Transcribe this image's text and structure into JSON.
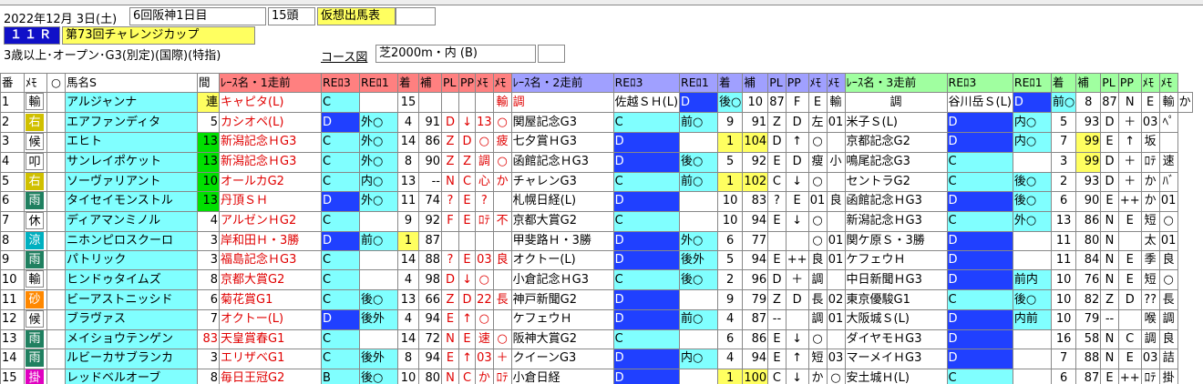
{
  "header": {
    "date": "2022年12月 3日(土)",
    "meeting": "6回阪神1日目",
    "heads": "15頭",
    "mode_badge": "仮想出馬表",
    "race_no": "１１Ｒ",
    "race_name": "第73回チャレンジカップ",
    "conditions": "3歳以上･オープン･G3(別定)(国際)(特指)",
    "course_label": "コース図",
    "course": "芝2000m・内 (B)"
  },
  "columns": {
    "no": "番",
    "memo": "ﾒﾓ",
    "mark": "○",
    "horse": "馬名S",
    "gap": "間",
    "race1": "ﾚｰｽ名・1走前",
    "race2": "ﾚｰｽ名・2走前",
    "race3": "ﾚｰｽ名・3走前",
    "rpci3": "REﾛ3",
    "rpci1": "REﾛ1",
    "pos": "着",
    "ho": "補",
    "pl": "PL",
    "pp": "PP",
    "me": "ﾒﾓ",
    "me2": "ﾒﾓ"
  },
  "colors": {
    "hdr_race1": "#ff8080",
    "hdr_race2": "#a0a0ff",
    "hdr_race3": "#a0ffa0",
    "horse_bg": "#80ffff",
    "blue_cell": "#2040ff",
    "green_gap": "#00e000"
  },
  "rows": [
    {
      "no": "1",
      "badge": "輸",
      "bc": "b-ring",
      "name": "アルジャンナ",
      "gap": "連",
      "gc": "yb",
      "r1": [
        "キャピタ(L)",
        "C",
        "",
        "15",
        "",
        "",
        "",
        "",
        "輸",
        "調"
      ],
      "r2": [
        "佐越ＳＨ(L)",
        "D",
        "後○",
        "10",
        "87",
        "F",
        "E",
        "輸",
        "調"
      ],
      "r3": [
        "谷川岳Ｓ(L)",
        "D",
        "前○",
        "8",
        "87",
        "N",
        "E",
        "輸",
        "か"
      ]
    },
    {
      "no": "2",
      "badge": "右",
      "bc": "b-ye",
      "name": "エアファンディタ",
      "gap": "5",
      "gc": "",
      "r1": [
        "カシオペ(L)",
        "D",
        "外○",
        "4",
        "91",
        "D",
        "↓",
        "13",
        "○"
      ],
      "r2": [
        "関屋記念G3",
        "C",
        "前○",
        "9",
        "91",
        "Z",
        "D",
        "左",
        "01"
      ],
      "r3": [
        "米子Ｓ(L)",
        "D",
        "内○",
        "5",
        "93",
        "D",
        "＋",
        "03",
        "ﾍﾟ"
      ]
    },
    {
      "no": "3",
      "badge": "候",
      "bc": "b-ring",
      "name": "エヒト",
      "gap": "13",
      "gc": "gr",
      "r1": [
        "新潟記念ＨG3",
        "C",
        "外○",
        "14",
        "86",
        "Z",
        "D",
        "○",
        "疲"
      ],
      "r2": [
        "七夕賞ＨG3",
        "D",
        "",
        "1",
        "104",
        "D",
        "↑",
        "○",
        ""
      ],
      "r3": [
        "京都記念G2",
        "D",
        "内○",
        "7",
        "99",
        "E",
        "↑",
        "坂",
        ""
      ]
    },
    {
      "no": "4",
      "badge": "叩",
      "bc": "b-ring",
      "name": "サンレイポケット",
      "gap": "13",
      "gc": "gr",
      "r1": [
        "新潟記念ＨG3",
        "C",
        "外○",
        "8",
        "90",
        "Z",
        "Z",
        "調",
        "○"
      ],
      "r2": [
        "函館記念ＨG3",
        "D",
        "後○",
        "5",
        "92",
        "E",
        "D",
        "瘦",
        "小"
      ],
      "r3": [
        "鳴尾記念G3",
        "C",
        "",
        "3",
        "99",
        "D",
        "＋",
        "ﾛﾃ",
        "速"
      ]
    },
    {
      "no": "5",
      "badge": "右",
      "bc": "b-ye",
      "name": "ソーヴァリアント",
      "gap": "10",
      "gc": "gr",
      "r1": [
        "オールカG2",
        "C",
        "内○",
        "13",
        "--",
        "N",
        "C",
        "心",
        "か"
      ],
      "r2": [
        "チャレンG3",
        "C",
        "前○",
        "1",
        "102",
        "C",
        "↓",
        "○",
        ""
      ],
      "r3": [
        "セントラG2",
        "C",
        "後○",
        "2",
        "93",
        "D",
        "＋",
        "か",
        "ﾊﾞ"
      ]
    },
    {
      "no": "6",
      "badge": "雨",
      "bc": "b-gr",
      "name": "タイセイモンストル",
      "gap": "13",
      "gc": "gr",
      "r1": [
        "丹頂ＳＨ",
        "D",
        "外○",
        "11",
        "74",
        "?",
        "E",
        "?",
        ""
      ],
      "r2": [
        "札幌日経(L)",
        "D",
        "",
        "10",
        "83",
        "?",
        "E",
        "01",
        "良"
      ],
      "r3": [
        "函館記念ＨG3",
        "D",
        "後○",
        "6",
        "90",
        "E",
        "++",
        "か",
        "01"
      ]
    },
    {
      "no": "7",
      "badge": "休",
      "bc": "b-ring",
      "name": "ディアマンミノル",
      "gap": "4",
      "gc": "",
      "r1": [
        "アルゼンＨG2",
        "C",
        "",
        "9",
        "92",
        "F",
        "E",
        "ﾛﾃ",
        "不"
      ],
      "r2": [
        "京都大賞G2",
        "C",
        "",
        "10",
        "94",
        "E",
        "↓",
        "○",
        ""
      ],
      "r3": [
        "新潟記念ＨG3",
        "C",
        "外○",
        "13",
        "86",
        "N",
        "E",
        "短",
        "○"
      ]
    },
    {
      "no": "8",
      "badge": "涼",
      "bc": "b-cy",
      "name": "ニホンピロスクーロ",
      "gap": "3",
      "gc": "",
      "r1": [
        "岸和田Ｈ・3勝",
        "D",
        "前○",
        "1",
        "87",
        "",
        "",
        "",
        ""
      ],
      "r2": [
        "甲斐路Ｈ・3勝",
        "D",
        "外○",
        "6",
        "77",
        "",
        "",
        "○",
        "01"
      ],
      "r3": [
        "関ケ原Ｓ・3勝",
        "D",
        "",
        "11",
        "80",
        "N",
        "",
        "太",
        "01"
      ]
    },
    {
      "no": "9",
      "badge": "雨",
      "bc": "b-gr",
      "name": "パトリック",
      "gap": "3",
      "gc": "",
      "r1": [
        "福島記念ＨG3",
        "C",
        "",
        "14",
        "88",
        "?",
        "E",
        "03",
        "良"
      ],
      "r2": [
        "オクトー(L)",
        "D",
        "後外",
        "5",
        "94",
        "E",
        "++",
        "良",
        "01"
      ],
      "r3": [
        "ケフェウＨ",
        "D",
        "",
        "11",
        "84",
        "N",
        "E",
        "季",
        "良"
      ]
    },
    {
      "no": "10",
      "badge": "輸",
      "bc": "b-ring",
      "name": "ヒンドゥタイムズ",
      "gap": "8",
      "gc": "",
      "r1": [
        "京都大賞G2",
        "C",
        "",
        "4",
        "98",
        "D",
        "↓",
        "○",
        ""
      ],
      "r2": [
        "小倉記念ＨG3",
        "C",
        "後○",
        "2",
        "96",
        "D",
        "＋",
        "調",
        ""
      ],
      "r3": [
        "中日新聞ＨG3",
        "D",
        "前内",
        "10",
        "76",
        "N",
        "E",
        "短",
        "○"
      ]
    },
    {
      "no": "11",
      "badge": "砂",
      "bc": "b-or",
      "name": "ビーアストニッシド",
      "gap": "6",
      "gc": "",
      "r1": [
        "菊花賞G1",
        "C",
        "後○",
        "13",
        "66",
        "Z",
        "D",
        "22",
        "長"
      ],
      "r2": [
        "神戸新聞G2",
        "D",
        "",
        "9",
        "79",
        "Z",
        "D",
        "長",
        "02"
      ],
      "r3": [
        "東京優駿G1",
        "C",
        "後○",
        "10",
        "82",
        "Z",
        "D",
        "??",
        "長"
      ]
    },
    {
      "no": "12",
      "badge": "候",
      "bc": "b-ring",
      "name": "ブラヴァス",
      "gap": "7",
      "gc": "",
      "r1": [
        "オクトー(L)",
        "D",
        "後外",
        "4",
        "94",
        "E",
        "↑",
        "○",
        ""
      ],
      "r2": [
        "ケフェウＨ",
        "D",
        "前○",
        "4",
        "87",
        "--",
        "",
        "調",
        "01"
      ],
      "r3": [
        "大阪城Ｓ(L)",
        "D",
        "内前",
        "10",
        "79",
        "--",
        "",
        "喉",
        "調"
      ]
    },
    {
      "no": "13",
      "badge": "雨",
      "bc": "b-gr",
      "name": "メイショウテンゲン",
      "gap": "83",
      "gc": "rd",
      "r1": [
        "天皇賞春G1",
        "C",
        "",
        "14",
        "72",
        "N",
        "E",
        "速",
        "○"
      ],
      "r2": [
        "阪神大賞G2",
        "C",
        "",
        "6",
        "86",
        "E",
        "↓",
        "○",
        ""
      ],
      "r3": [
        "ダイヤモＨG3",
        "D",
        "",
        "16",
        "58",
        "N",
        "C",
        "調",
        "良"
      ]
    },
    {
      "no": "14",
      "badge": "雨",
      "bc": "b-gr",
      "name": "ルビーカサブランカ",
      "gap": "3",
      "gc": "",
      "r1": [
        "エリザベG1",
        "C",
        "後外",
        "8",
        "94",
        "E",
        "↑",
        "03",
        "＋"
      ],
      "r2": [
        "クイーンG3",
        "D",
        "内○",
        "4",
        "94",
        "E",
        "↑",
        "短",
        "03"
      ],
      "r3": [
        "マーメイＨG3",
        "D",
        "",
        "7",
        "88",
        "N",
        "E",
        "03",
        "詰"
      ]
    },
    {
      "no": "15",
      "badge": "掛",
      "bc": "b-pk",
      "name": "レッドベルオーブ",
      "gap": "8",
      "gc": "",
      "r1": [
        "毎日王冠G2",
        "B",
        "後○",
        "10",
        "80",
        "N",
        "C",
        "か",
        "ﾛﾃ"
      ],
      "r2": [
        "小倉日経",
        "D",
        "",
        "1",
        "100",
        "C",
        "↓",
        "か",
        "○"
      ],
      "r3": [
        "安土城Ｈ(L)",
        "C",
        "",
        "6",
        "87",
        "E",
        "++",
        "ﾛﾃ",
        "掛"
      ]
    }
  ]
}
